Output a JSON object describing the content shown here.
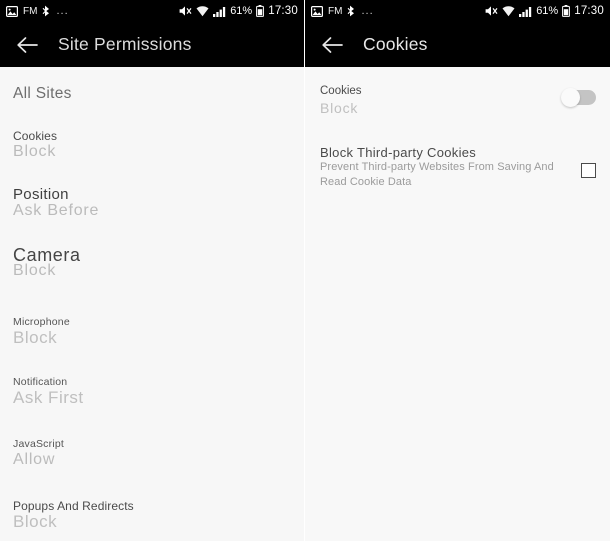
{
  "status_bar": {
    "icons_left": [
      "image-icon",
      "fm-label",
      "bluetooth-share-icon",
      "more-dots-icon"
    ],
    "fm_label": "FM",
    "more_dots": "...",
    "icons_right": [
      "mute-icon",
      "wifi-icon",
      "signal-icon",
      "battery-icon"
    ],
    "battery_percent": "61%",
    "time": "17:30"
  },
  "left_screen": {
    "appbar": {
      "back_icon": "arrow-left-icon",
      "title": "Site Permissions"
    },
    "section_header": "All Sites",
    "items": [
      {
        "title": "Cookies",
        "value": "Block"
      },
      {
        "title": "Position",
        "value": "Ask Before"
      },
      {
        "title": "Camera",
        "value": "Block"
      },
      {
        "title": "Microphone",
        "value": "Block"
      },
      {
        "title": "Notification",
        "value": "Ask First"
      },
      {
        "title": "JavaScript",
        "value": "Allow"
      },
      {
        "title": "Popups And Redirects",
        "value": "Block"
      }
    ]
  },
  "right_screen": {
    "appbar": {
      "back_icon": "arrow-left-icon",
      "title": "Cookies"
    },
    "cookies_row": {
      "title": "Cookies",
      "value": "Block",
      "toggle_state": "off"
    },
    "third_party_row": {
      "title": "Block Third-party Cookies",
      "description": "Prevent Third-party Websites From Saving And Read Cookie Data",
      "checkbox_state": "unchecked"
    }
  },
  "colors": {
    "statusbar_bg": "#000000",
    "appbar_bg": "#000000",
    "page_bg": "#f7f7f7",
    "title_text": "#4a4a4a",
    "value_text": "#bdbdbd",
    "toggle_track": "#c4c4c4"
  }
}
